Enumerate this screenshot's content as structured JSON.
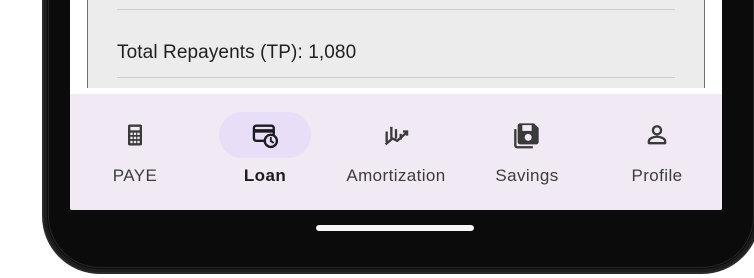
{
  "summary": {
    "total_repayments": "Total Repayents (TP): 1,080"
  },
  "nav": {
    "items": [
      {
        "label": "PAYE",
        "icon": "calculator-icon",
        "active": false
      },
      {
        "label": "Loan",
        "icon": "loan-card-clock-icon",
        "active": true
      },
      {
        "label": "Amortization",
        "icon": "amortization-chart-icon",
        "active": false
      },
      {
        "label": "Savings",
        "icon": "savings-save-icon",
        "active": false
      },
      {
        "label": "Profile",
        "icon": "profile-person-icon",
        "active": false
      }
    ]
  },
  "colors": {
    "nav_background": "#f1e9f3",
    "active_indicator": "#e8def8",
    "card_background": "#ececec",
    "icon_color": "#3a3a3a"
  }
}
